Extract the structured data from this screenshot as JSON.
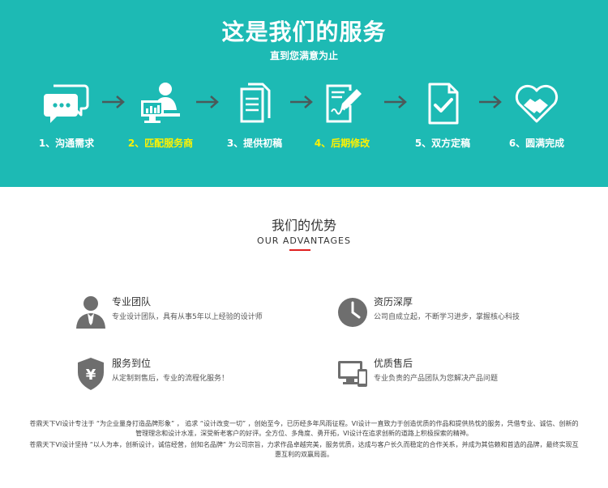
{
  "hero": {
    "title": "这是我们的服务",
    "subtitle": "直到您满意为止",
    "bg_color": "#1dbab4",
    "steps": [
      {
        "label": "1、沟通需求",
        "icon": "chat-bubbles-icon",
        "highlight": false
      },
      {
        "label": "2、匹配服务商",
        "icon": "designer-at-computer-icon",
        "highlight": true
      },
      {
        "label": "3、提供初稿",
        "icon": "documents-icon",
        "highlight": false
      },
      {
        "label": "4、后期修改",
        "icon": "edit-document-icon",
        "highlight": true
      },
      {
        "label": "5、双方定稿",
        "icon": "checked-document-icon",
        "highlight": false
      },
      {
        "label": "6、圆满完成",
        "icon": "heart-handshake-icon",
        "highlight": false
      }
    ]
  },
  "advantages": {
    "title": "我们的优势",
    "subtitle": "OUR  ADVANTAGES",
    "accent_color": "#e02020",
    "items": [
      {
        "title": "专业团队",
        "desc": "专业设计团队，具有从事5年以上经验的设计师",
        "icon": "businessman-icon"
      },
      {
        "title": "资历深厚",
        "desc": "公司自成立起，不断学习进步，掌握核心科技",
        "icon": "clock-icon"
      },
      {
        "title": "服务到位",
        "desc": "从定制到售后，专业的流程化服务！",
        "icon": "yen-shield-icon"
      },
      {
        "title": "优质售后",
        "desc": "专业负责的产品团队为您解决产品问题",
        "icon": "devices-icon"
      }
    ]
  },
  "footer": {
    "lines": [
      "苍鼎天下VI设计专注于 “为企业量身打造品牌形象” ， 追求 “设计改变一切” ，创始至今，已历经多年风雨征程。VI设计一直致力于创造优质的作品和提供热忱的服务，凭借专业、诚信、创新的",
      "管理理念和设计水准，深受新老客户的好评。全方位、多角度、勇开拓，VI设计在追求创新的道路上积极探索的精神。",
      "苍鼎天下VI设计坚持 “以人为本，创新设计，诚信经营，创知名品牌” 为公司宗旨，力求作品卓越完美，服务优质，达成与客户长久而稳定的合作关系，并成为其信赖和首选的品牌，最终实现互",
      "惠互利的双赢局面。"
    ]
  }
}
